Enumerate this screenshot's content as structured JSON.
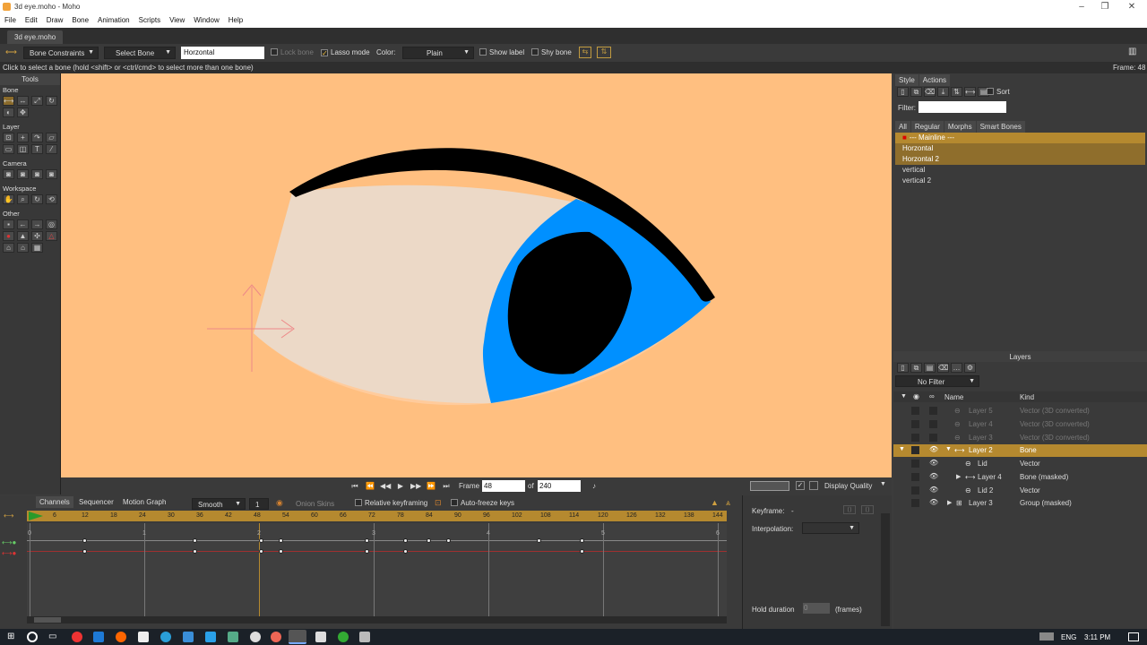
{
  "window": {
    "title": "3d eye.moho - Moho"
  },
  "menu": [
    "File",
    "Edit",
    "Draw",
    "Bone",
    "Animation",
    "Scripts",
    "View",
    "Window",
    "Help"
  ],
  "doc_tab": "3d eye.moho",
  "tool_options": {
    "constraints": "Bone Constraints",
    "select_bone": "Select Bone",
    "bone_name": "Horzontal",
    "lock_bone": "Lock bone",
    "lasso_mode": "Lasso mode",
    "color_label": "Color:",
    "color_value": "Plain",
    "show_label": "Show label",
    "shy_bone": "Shy bone",
    "frame_display": "Frame: 48"
  },
  "status_text": "Click to select a bone (hold <shift> or <ctrl/cmd> to select more than one bone)",
  "tools": {
    "header": "Tools",
    "sections": [
      "Bone",
      "Layer",
      "Camera",
      "Workspace",
      "Other"
    ]
  },
  "playbar": {
    "frame_label": "Frame",
    "frame_value": "48",
    "of_label": "of",
    "total": "240",
    "display_quality": "Display Quality"
  },
  "style_tabs": [
    "Style",
    "Actions"
  ],
  "actions": {
    "sort": "Sort",
    "filter_label": "Filter:",
    "tabs": [
      "All",
      "Regular",
      "Morphs",
      "Smart Bones"
    ],
    "items": [
      "--- Mainline ---",
      "Horzontal",
      "Horzontal 2",
      "vertical",
      "vertical 2"
    ]
  },
  "layers": {
    "title": "Layers",
    "filter": "No Filter",
    "col_name": "Name",
    "col_kind": "Kind",
    "rows": [
      {
        "name": "Layer 5",
        "kind": "Vector (3D converted)"
      },
      {
        "name": "Layer 4",
        "kind": "Vector (3D converted)"
      },
      {
        "name": "Layer 3",
        "kind": "Vector (3D converted)"
      },
      {
        "name": "Layer 2",
        "kind": "Bone"
      },
      {
        "name": "Lid",
        "kind": "Vector"
      },
      {
        "name": "Layer 4",
        "kind": "Bone (masked)"
      },
      {
        "name": "Lid 2",
        "kind": "Vector"
      },
      {
        "name": "Layer 3",
        "kind": "Group (masked)"
      }
    ]
  },
  "timeline": {
    "tabs": [
      "Channels",
      "Sequencer",
      "Motion Graph"
    ],
    "interp": "Smooth",
    "interp_num": "1",
    "onion": "Onion Skins",
    "relative": "Relative keyframing",
    "autofreeze": "Auto-freeze keys",
    "ruler": [
      "0",
      "6",
      "12",
      "18",
      "24",
      "30",
      "36",
      "42",
      "48",
      "54",
      "60",
      "66",
      "72",
      "78",
      "84",
      "90",
      "96",
      "102",
      "108",
      "114",
      "120",
      "126",
      "132",
      "138",
      "144"
    ],
    "seconds": [
      "0",
      "1",
      "2",
      "3",
      "4",
      "5",
      "6"
    ],
    "keyframe_label": "Keyframe:",
    "keyframe_value": "-",
    "interpolation_label": "Interpolation:",
    "hold_label": "Hold duration",
    "hold_value": "0",
    "hold_unit": "(frames)"
  },
  "taskbar": {
    "lang": "ENG",
    "time": "3:11 PM"
  },
  "colors": {
    "canvas_bg": "#ffbf80",
    "accent": "#b5892f",
    "iris": "#0090ff",
    "sclera": "#ecd9c7"
  }
}
